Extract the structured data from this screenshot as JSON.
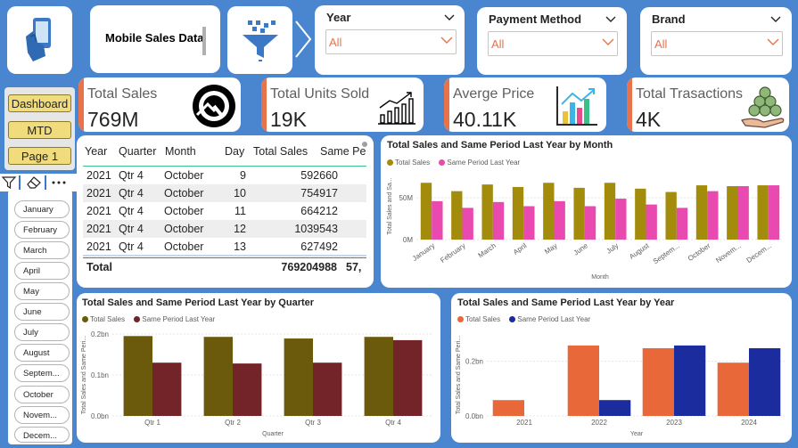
{
  "header": {
    "report_title": "Mobile Sales Data"
  },
  "slicers": {
    "year": {
      "label": "Year",
      "value": "All"
    },
    "payment": {
      "label": "Payment Method",
      "value": "All"
    },
    "brand": {
      "label": "Brand",
      "value": "All"
    }
  },
  "nav": {
    "dashboard": "Dashboard",
    "mtd": "MTD",
    "page1": "Page 1"
  },
  "months": [
    "January",
    "February",
    "March",
    "April",
    "May",
    "June",
    "July",
    "August",
    "Septem...",
    "October",
    "Novem...",
    "Decem..."
  ],
  "kpis": [
    {
      "title": "Total Sales",
      "value": "769M",
      "icon": "gauge-icon"
    },
    {
      "title": "Total Units Sold",
      "value": "19K",
      "icon": "growth-chart-icon"
    },
    {
      "title": "Averge Price",
      "value": "40.11K",
      "icon": "bar-chart-icon"
    },
    {
      "title": "Total Trasactions",
      "value": "4K",
      "icon": "coins-hand-icon"
    }
  ],
  "table": {
    "headers": [
      "Year",
      "Quarter",
      "Month",
      "Day",
      "Total Sales",
      "Same Pe"
    ],
    "rows": [
      [
        "2021",
        "Qtr 4",
        "October",
        "9",
        "592660"
      ],
      [
        "2021",
        "Qtr 4",
        "October",
        "10",
        "754917"
      ],
      [
        "2021",
        "Qtr 4",
        "October",
        "11",
        "664212"
      ],
      [
        "2021",
        "Qtr 4",
        "October",
        "12",
        "1039543"
      ],
      [
        "2021",
        "Qtr 4",
        "October",
        "13",
        "627492"
      ]
    ],
    "total_label": "Total",
    "total_sales": "769204988",
    "total_same": "57,"
  },
  "colors": {
    "accent": "#e8734a",
    "month_sales": "#a38c0c",
    "month_sply": "#e84ab0",
    "quarter_sales": "#6b5a0b",
    "quarter_sply": "#722428",
    "year_sales": "#e8683a",
    "year_sply": "#1a2c9e"
  },
  "chart_data": [
    {
      "type": "bar",
      "title": "Total Sales and Same Period Last Year by Month",
      "xlabel": "Month",
      "ylabel": "Total Sales and Sa...",
      "categories": [
        "January",
        "February",
        "March",
        "April",
        "May",
        "June",
        "July",
        "August",
        "Septem...",
        "October",
        "Novem...",
        "Decem..."
      ],
      "series": [
        {
          "name": "Total Sales",
          "values": [
            68,
            58,
            66,
            63,
            68,
            62,
            68,
            61,
            57,
            65,
            64,
            65
          ]
        },
        {
          "name": "Same Period Last Year",
          "values": [
            46,
            38,
            45,
            40,
            46,
            40,
            49,
            42,
            38,
            58,
            64,
            65
          ]
        }
      ],
      "yticks": [
        "0M",
        "50M"
      ],
      "ylim": [
        0,
        80
      ],
      "legend": "top-left"
    },
    {
      "type": "bar",
      "title": "Total Sales and Same Period Last Year by Quarter",
      "xlabel": "Quarter",
      "ylabel": "Total Sales and Same Peri...",
      "categories": [
        "Qtr 1",
        "Qtr 2",
        "Qtr 3",
        "Qtr 4"
      ],
      "series": [
        {
          "name": "Total Sales",
          "values": [
            0.195,
            0.193,
            0.189,
            0.193
          ]
        },
        {
          "name": "Same Period Last Year",
          "values": [
            0.13,
            0.128,
            0.13,
            0.185
          ]
        }
      ],
      "yticks": [
        "0.0bn",
        "0.1bn",
        "0.2bn"
      ],
      "ylim": [
        0,
        0.2
      ],
      "legend": "top-left"
    },
    {
      "type": "bar",
      "title": "Total Sales and Same Period Last Year by Year",
      "xlabel": "Year",
      "ylabel": "Total Sales and Same Peri...",
      "categories": [
        "2021",
        "2022",
        "2023",
        "2024"
      ],
      "series": [
        {
          "name": "Total Sales",
          "values": [
            0.058,
            0.258,
            0.248,
            0.195
          ]
        },
        {
          "name": "Same Period Last Year",
          "values": [
            null,
            0.058,
            0.258,
            0.248
          ]
        }
      ],
      "yticks": [
        "0.0bn",
        "0.2bn"
      ],
      "ylim": [
        0,
        0.3
      ],
      "legend": "top-left"
    }
  ]
}
